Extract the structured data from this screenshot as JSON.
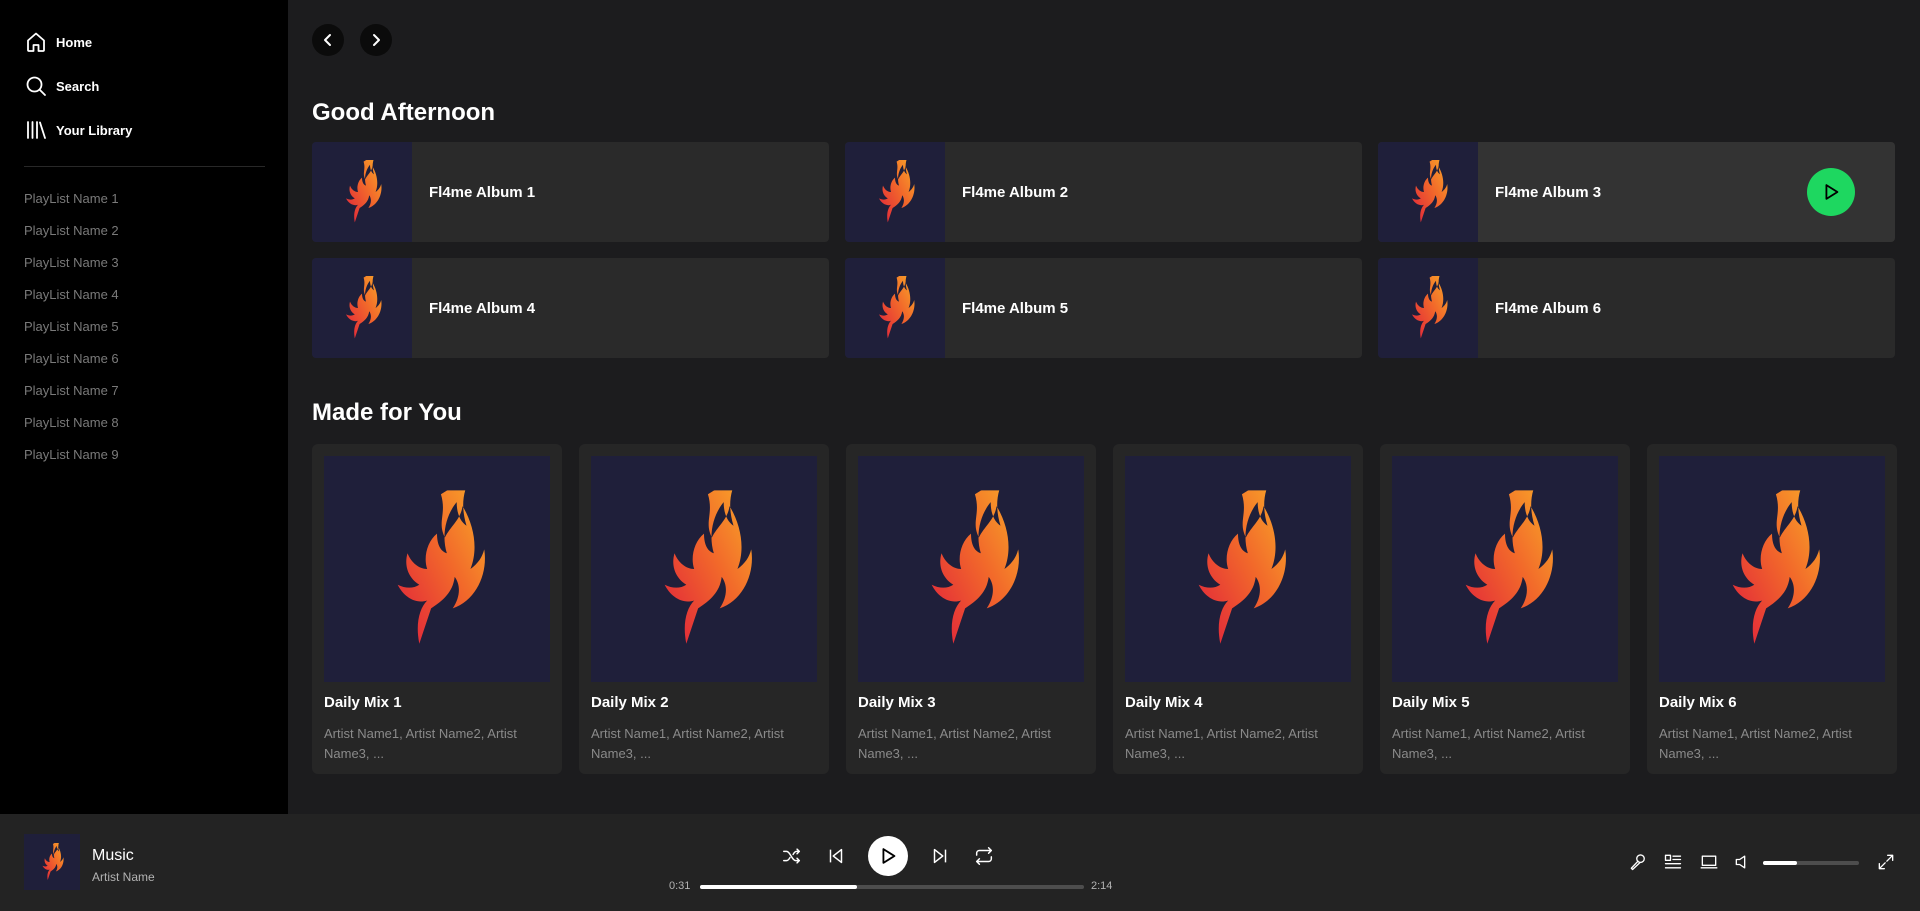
{
  "sidebar": {
    "nav": [
      {
        "label": "Home",
        "icon": "home-icon"
      },
      {
        "label": "Search",
        "icon": "search-icon"
      },
      {
        "label": "Your Library",
        "icon": "library-icon"
      }
    ],
    "playlists": [
      "PlayList Name 1",
      "PlayList Name 2",
      "PlayList Name 3",
      "PlayList Name 4",
      "PlayList Name 5",
      "PlayList Name 6",
      "PlayList Name 7",
      "PlayList Name 8",
      "PlayList Name 9"
    ]
  },
  "main": {
    "greeting": "Good Afternoon",
    "albums": [
      {
        "title": "Fl4me Album 1"
      },
      {
        "title": "Fl4me Album 2"
      },
      {
        "title": "Fl4me Album 3"
      },
      {
        "title": "Fl4me Album 4"
      },
      {
        "title": "Fl4me Album 5"
      },
      {
        "title": "Fl4me Album 6"
      }
    ],
    "made_for_you_title": "Made for You",
    "mixes": [
      {
        "title": "Daily Mix 1",
        "subtitle": "Artist Name1, Artist Name2, Artist Name3, ..."
      },
      {
        "title": "Daily Mix 2",
        "subtitle": "Artist Name1, Artist Name2, Artist Name3, ..."
      },
      {
        "title": "Daily Mix 3",
        "subtitle": "Artist Name1, Artist Name2, Artist Name3, ..."
      },
      {
        "title": "Daily Mix 4",
        "subtitle": "Artist Name1, Artist Name2, Artist Name3, ..."
      },
      {
        "title": "Daily Mix 5",
        "subtitle": "Artist Name1, Artist Name2, Artist Name3, ..."
      },
      {
        "title": "Daily Mix 6",
        "subtitle": "Artist Name1, Artist Name2, Artist Name3, ..."
      }
    ]
  },
  "player": {
    "track_title": "Music",
    "artist": "Artist Name",
    "elapsed": "0:31",
    "duration": "2:14",
    "progress_fraction": 0.41,
    "volume_fraction": 0.35
  },
  "colors": {
    "accent": "#1ed760",
    "sidebar_bg": "#000000",
    "main_bg": "#1c1c1e",
    "card_bg": "#2a2a2a",
    "cover_bg": "#1f1f3a"
  }
}
